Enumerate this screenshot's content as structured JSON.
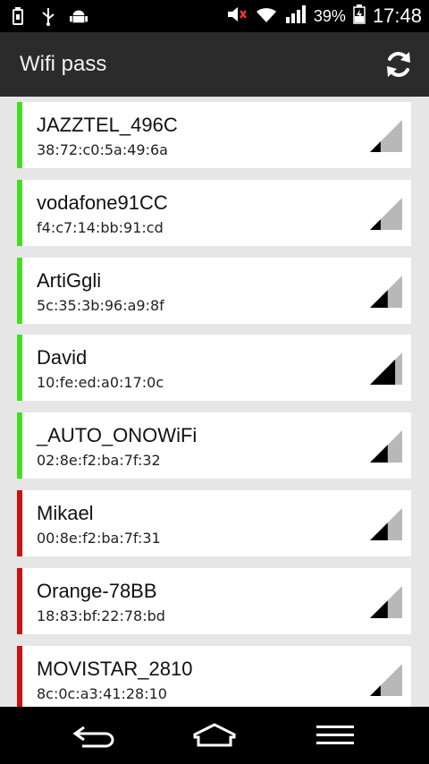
{
  "status_bar": {
    "battery_percent": "39%",
    "time": "17:48"
  },
  "app_bar": {
    "title": "Wifi pass"
  },
  "networks": [
    {
      "name": "JAZZTEL_496C",
      "mac": "38:72:c0:5a:49:6a",
      "status_color": "#44dd22",
      "signal_level": 1
    },
    {
      "name": "vodafone91CC",
      "mac": "f4:c7:14:bb:91:cd",
      "status_color": "#44dd22",
      "signal_level": 1
    },
    {
      "name": "ArtiGgli",
      "mac": "5c:35:3b:96:a9:8f",
      "status_color": "#44dd22",
      "signal_level": 2
    },
    {
      "name": "David",
      "mac": "10:fe:ed:a0:17:0c",
      "status_color": "#44dd22",
      "signal_level": 3
    },
    {
      "name": "_AUTO_ONOWiFi",
      "mac": "02:8e:f2:ba:7f:32",
      "status_color": "#44dd22",
      "signal_level": 2
    },
    {
      "name": "Mikael",
      "mac": "00:8e:f2:ba:7f:31",
      "status_color": "#cc1111",
      "signal_level": 2
    },
    {
      "name": "Orange-78BB",
      "mac": "18:83:bf:22:78:bd",
      "status_color": "#cc1111",
      "signal_level": 2
    },
    {
      "name": "MOVISTAR_2810",
      "mac": "8c:0c:a3:41:28:10",
      "status_color": "#cc1111",
      "signal_level": 1
    }
  ],
  "icons": {
    "status_left": [
      "usb-icon",
      "usb-debug-icon",
      "android-icon"
    ],
    "status_right": [
      "mute-icon",
      "wifi-icon",
      "cell-signal-icon",
      "battery-icon"
    ],
    "refresh": "refresh-icon",
    "nav": [
      "back-icon",
      "home-icon",
      "menu-icon"
    ]
  }
}
